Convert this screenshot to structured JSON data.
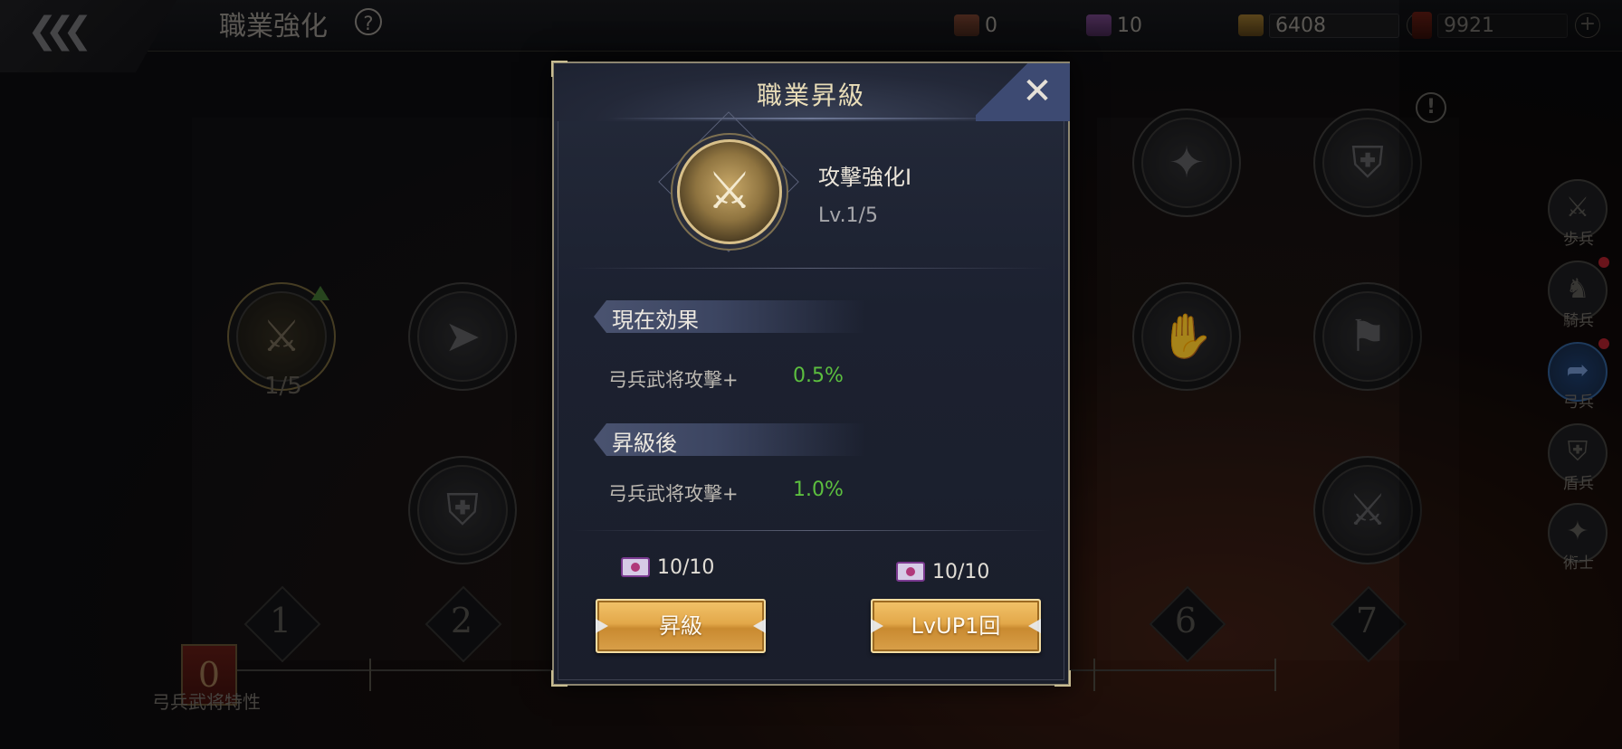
{
  "topbar": {
    "title": "職業強化",
    "resources": [
      {
        "icon": "skill-book-icon",
        "value": "0"
      },
      {
        "icon": "scroll-icon",
        "value": "10"
      },
      {
        "icon": "gold-ingot-icon",
        "value": "6408"
      },
      {
        "icon": "red-card-icon",
        "value": "9921"
      }
    ]
  },
  "background": {
    "node_progress": "1/5",
    "columns": [
      "1",
      "2",
      "6",
      "7"
    ],
    "trait_level": "0",
    "trait_label": "弓兵武将特性"
  },
  "side_tabs": [
    {
      "label": "歩兵",
      "icon": "infantry-icon"
    },
    {
      "label": "騎兵",
      "icon": "cavalry-icon"
    },
    {
      "label": "弓兵",
      "icon": "archer-icon",
      "active": true
    },
    {
      "label": "盾兵",
      "icon": "shield-soldier-icon"
    },
    {
      "label": "術士",
      "icon": "mage-icon"
    }
  ],
  "modal": {
    "title": "職業昇級",
    "skill_name": "攻擊強化I",
    "skill_level": "Lv.1/5",
    "current_section": "現在効果",
    "current_stat_label": "弓兵武将攻擊+",
    "current_stat_value": "0.5%",
    "after_section": "昇級後",
    "after_stat_label": "弓兵武将攻擊+",
    "after_stat_value": "1.0%",
    "cost_left": "10/10",
    "cost_right": "10/10",
    "upgrade_button": "昇級",
    "lvup_button": "LvUP1回"
  },
  "colors": {
    "accent_gold": "#e3a84a",
    "stat_green": "#5cbf3f",
    "title_text": "#e9ddb8"
  }
}
